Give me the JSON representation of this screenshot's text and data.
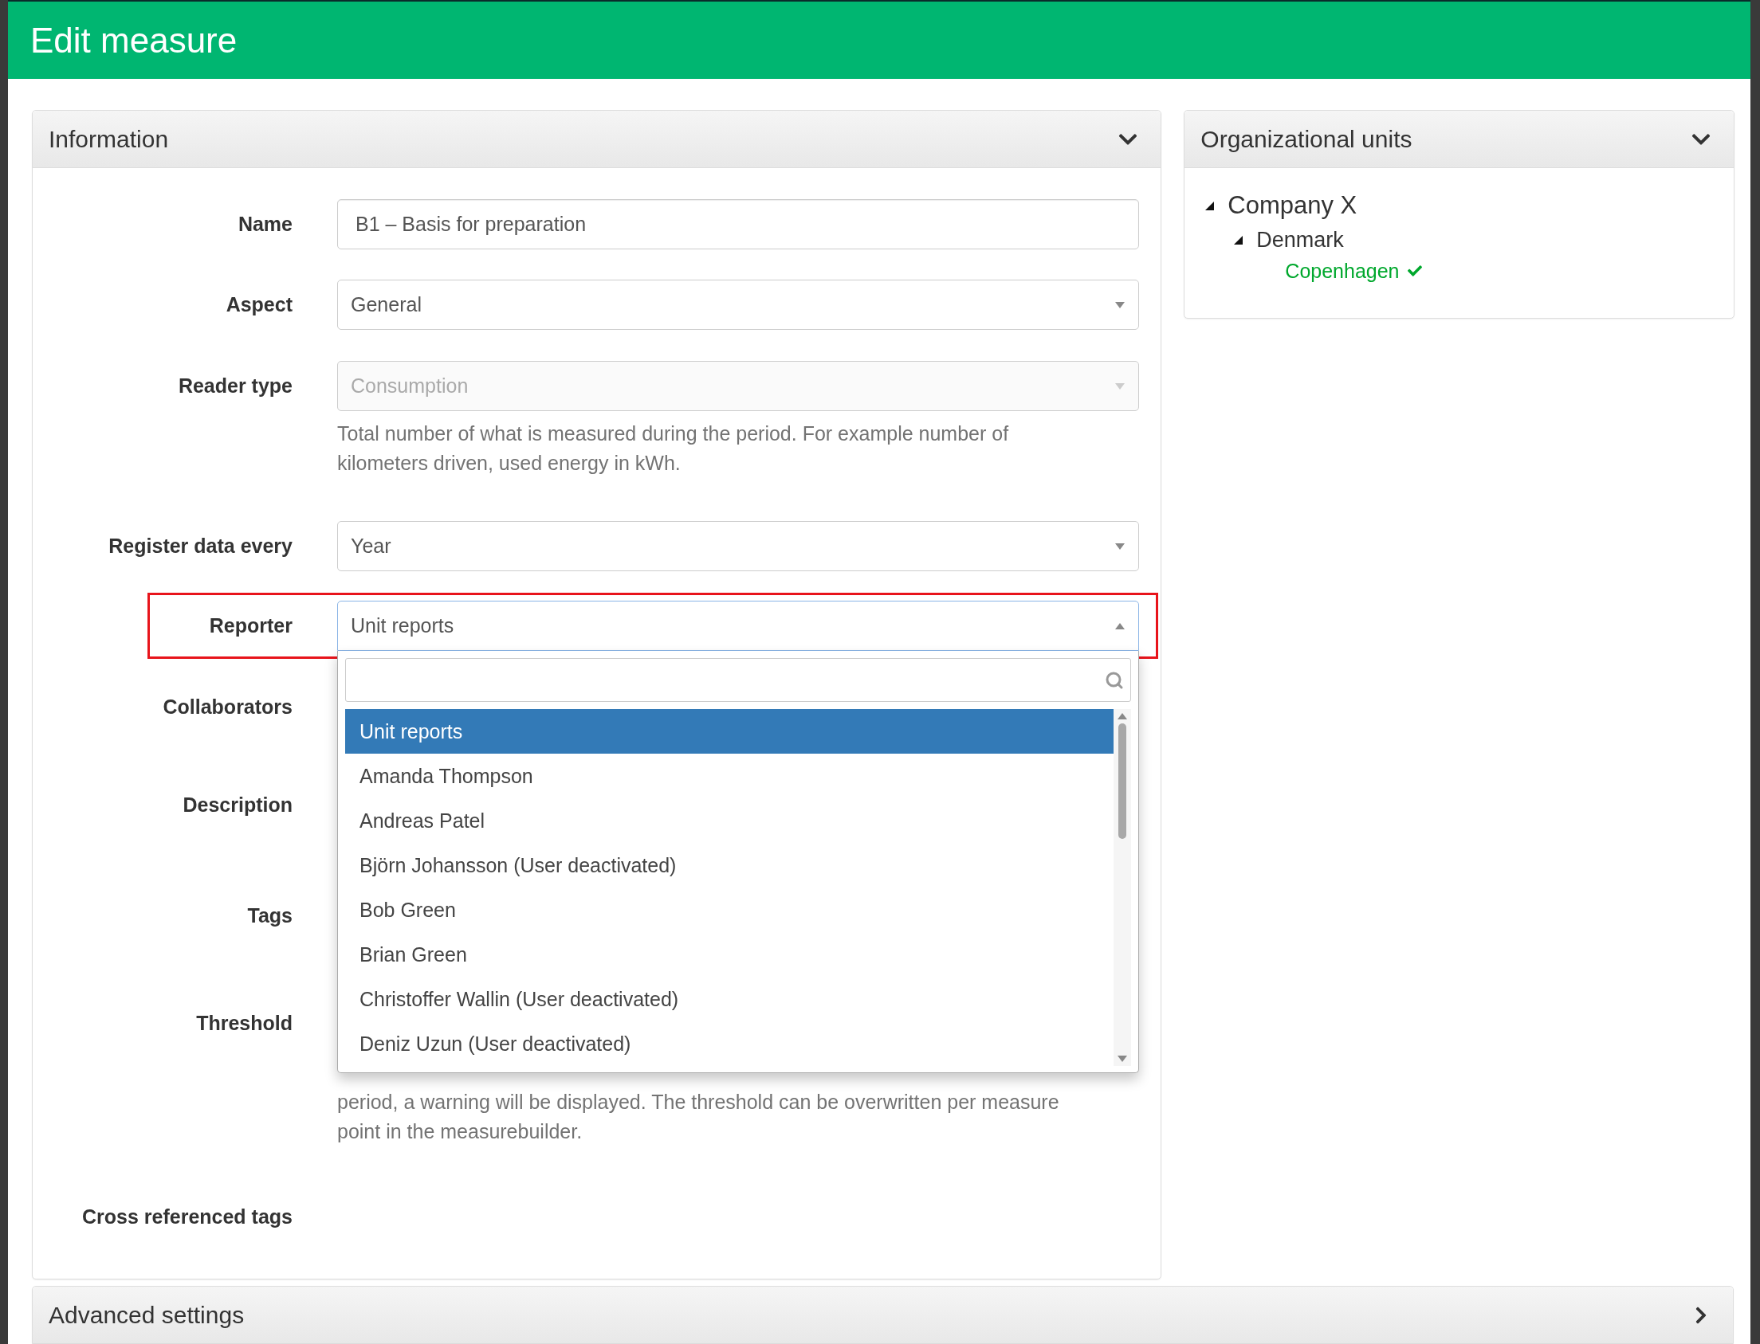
{
  "dialog": {
    "title": "Edit measure"
  },
  "information": {
    "title": "Information",
    "expanded": true,
    "fields": [
      {
        "kind": "text",
        "label": "Name",
        "value": "B1 – Basis for preparation"
      },
      {
        "kind": "select",
        "label": "Aspect",
        "value": "General",
        "disabled": false
      },
      {
        "kind": "select",
        "label": "Reader type",
        "value": "Consumption",
        "disabled": true,
        "help": "Total number of what is measured during the period. For example number of kilometers driven, used energy in kWh."
      },
      {
        "kind": "select",
        "label": "Register data every",
        "value": "Year",
        "disabled": false
      },
      {
        "kind": "dropdown",
        "label": "Reporter",
        "value": "Unit reports",
        "highlighted": true,
        "expanded": true,
        "options": [
          {
            "label": "Unit reports",
            "selected": true
          },
          {
            "label": "Amanda Thompson",
            "selected": false
          },
          {
            "label": "Andreas Patel",
            "selected": false
          },
          {
            "label": "Björn Johansson (User deactivated)",
            "selected": false
          },
          {
            "label": "Bob Green",
            "selected": false
          },
          {
            "label": "Brian Green",
            "selected": false
          },
          {
            "label": "Christoffer Wallin (User deactivated)",
            "selected": false
          },
          {
            "label": "Deniz Uzun (User deactivated)",
            "selected": false
          }
        ]
      },
      {
        "kind": "covered",
        "label": "Collaborators"
      },
      {
        "kind": "covered",
        "label": "Description"
      },
      {
        "kind": "covered",
        "label": "Tags"
      },
      {
        "kind": "covered",
        "label": "Threshold",
        "help": "period, a warning will be displayed. The threshold can be overwritten per measure point in the measurebuilder."
      },
      {
        "kind": "covered",
        "label": "Cross referenced tags"
      }
    ]
  },
  "organizational_units": {
    "title": "Organizational units",
    "expanded": true,
    "tree": [
      {
        "label": "Company X",
        "expanded": true,
        "selected": false,
        "children": [
          {
            "label": "Denmark",
            "expanded": true,
            "selected": false,
            "children": [
              {
                "label": "Copenhagen",
                "selected": true
              }
            ]
          }
        ]
      }
    ]
  },
  "advanced_settings": {
    "title": "Advanced settings",
    "expanded": false
  }
}
